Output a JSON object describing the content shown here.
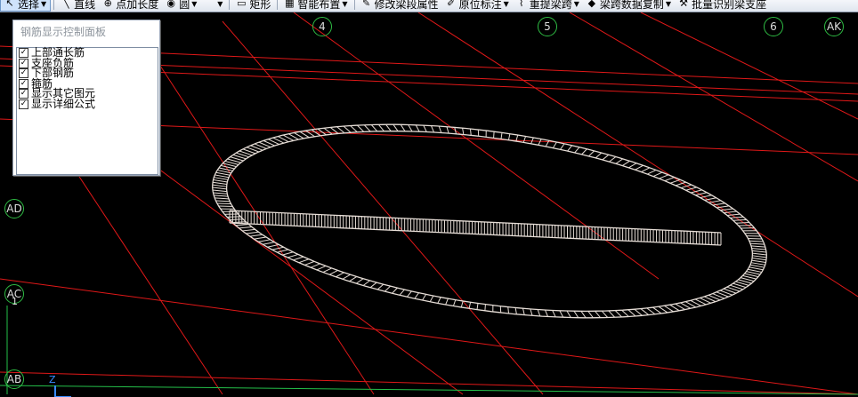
{
  "toolbar": {
    "items": [
      {
        "label": "选择",
        "icon": "↖",
        "dropdown": true,
        "active": true
      },
      {
        "label": "直线",
        "icon": "╲",
        "dropdown": false
      },
      {
        "label": "点加长度",
        "icon": "⊕",
        "dropdown": false
      },
      {
        "label": "圆",
        "icon": "◉",
        "dropdown": true
      },
      {
        "label": "",
        "icon": "",
        "dropdown": true
      },
      {
        "label": "矩形",
        "icon": "▭",
        "dropdown": false
      },
      {
        "label": "智能布置",
        "icon": "▦",
        "dropdown": true
      },
      {
        "label": "修改梁段属性",
        "icon": "✎",
        "dropdown": false
      },
      {
        "label": "原位标注",
        "icon": "✐",
        "dropdown": true
      },
      {
        "label": "重提梁跨",
        "icon": "⌇",
        "dropdown": true
      },
      {
        "label": "梁跨数据复制",
        "icon": "◆",
        "dropdown": true
      },
      {
        "label": "批量识别梁支座",
        "icon": "⚒",
        "dropdown": false
      }
    ]
  },
  "panel": {
    "title": "钢筋显示控制面板",
    "options": [
      {
        "label": "上部通长筋",
        "checked": true
      },
      {
        "label": "支座负筋",
        "checked": true
      },
      {
        "label": "下部钢筋",
        "checked": true
      },
      {
        "label": "箍筋",
        "checked": true
      },
      {
        "label": "显示其它图元",
        "checked": true
      },
      {
        "label": "显示详细公式",
        "checked": true
      }
    ]
  },
  "axes": {
    "top": [
      "4",
      "5",
      "6",
      "AK"
    ],
    "left": [
      "AD",
      "AC",
      "AB"
    ],
    "left_small": "1"
  },
  "colors": {
    "gridline": "#e01818",
    "axis_circle": "#2fbd44",
    "rebar": "#e6ddd6",
    "background": "#000000"
  },
  "icons": {
    "ucs": "ucs-axis-icon"
  }
}
